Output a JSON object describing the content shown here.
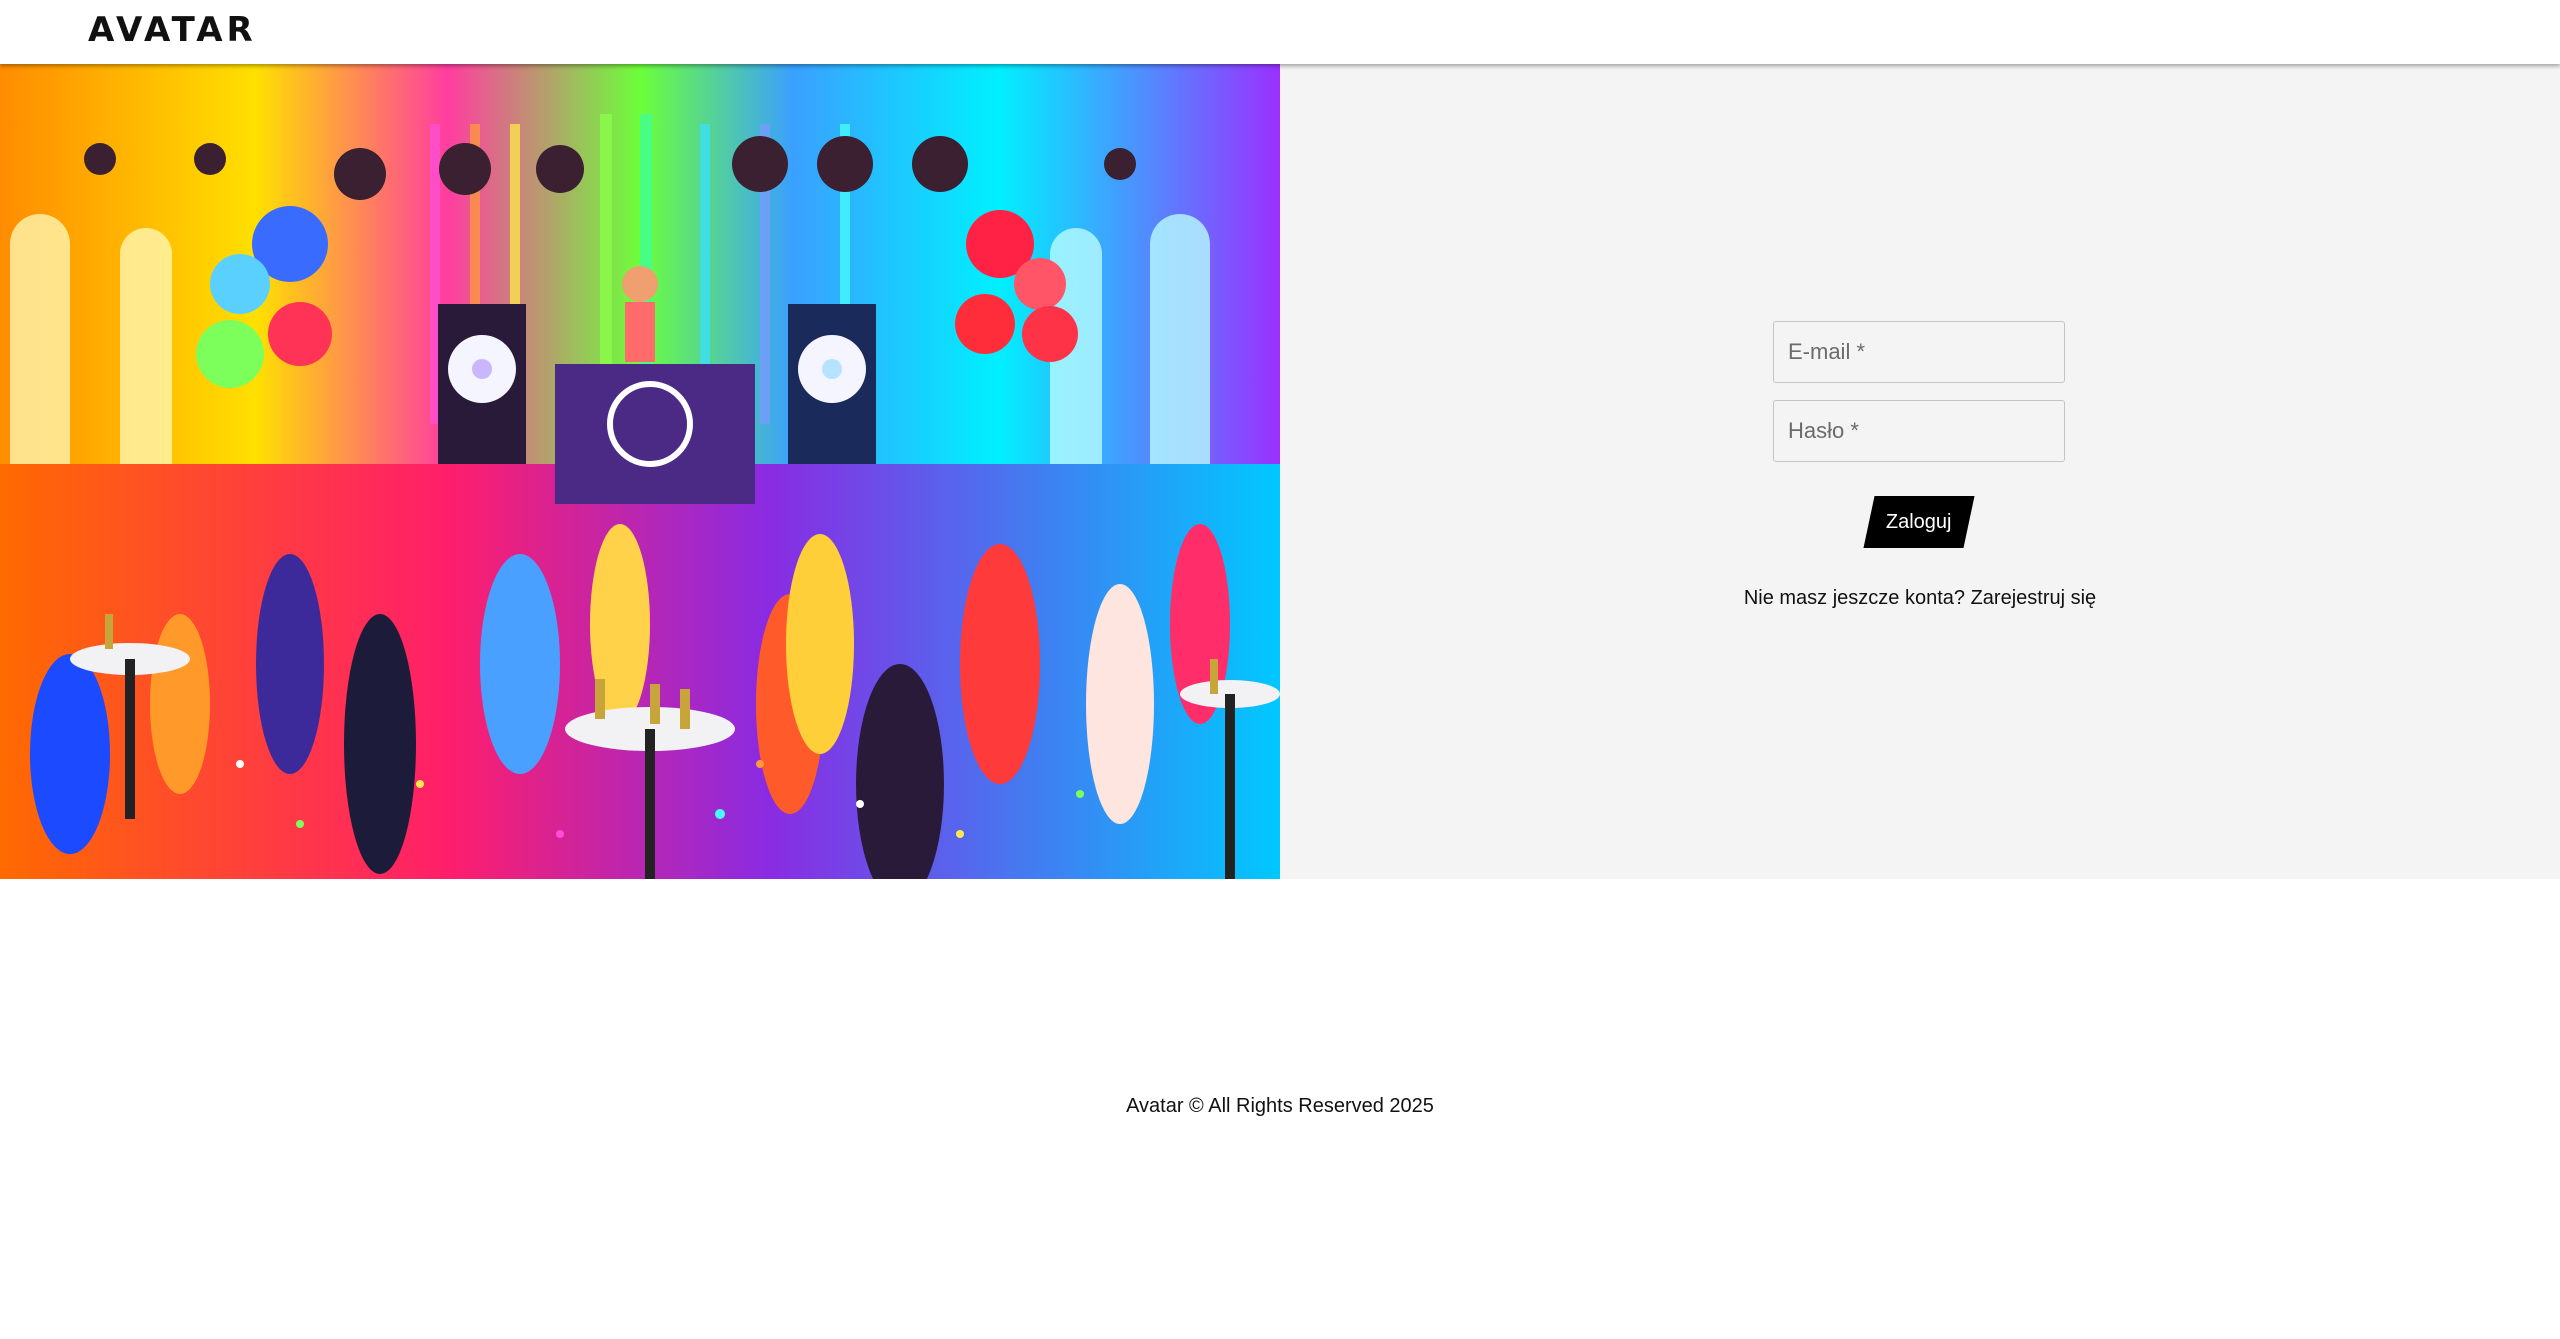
{
  "header": {
    "logo": "AVATAR"
  },
  "hero": {
    "image": "party-dancefloor-illustration"
  },
  "login": {
    "email_placeholder": "E-mail *",
    "password_placeholder": "Hasło *",
    "submit_label": "Zaloguj",
    "register_prompt": "Nie masz jeszcze konta?",
    "register_link": "Zarejestruj się"
  },
  "footer": {
    "copyright": "Avatar © All Rights Reserved 2025"
  },
  "colors": {
    "panel_bg": "#f4f4f4",
    "button_bg": "#000000",
    "text": "#111111"
  }
}
